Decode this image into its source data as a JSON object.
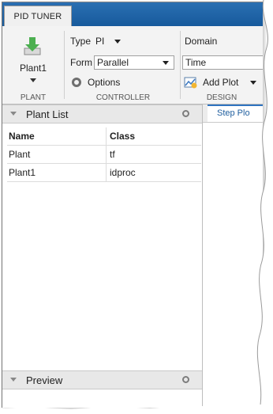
{
  "tab": {
    "label": "PID TUNER"
  },
  "plant_section": {
    "button_label": "Plant1",
    "section_label": "PLANT"
  },
  "controller_section": {
    "type_label": "Type",
    "type_value": "PI",
    "form_label": "Form",
    "form_value": "Parallel",
    "options_label": "Options",
    "section_label": "CONTROLLER"
  },
  "design_section": {
    "domain_label": "Domain",
    "domain_value": "Time",
    "add_plot_label": "Add Plot",
    "section_label": "DESIGN"
  },
  "plant_list": {
    "title": "Plant List",
    "columns": [
      "Name",
      "Class"
    ],
    "rows": [
      {
        "name": "Plant",
        "class": "tf"
      },
      {
        "name": "Plant1",
        "class": "idproc"
      }
    ]
  },
  "preview": {
    "title": "Preview"
  },
  "document_tab": {
    "label": "Step Plo"
  }
}
